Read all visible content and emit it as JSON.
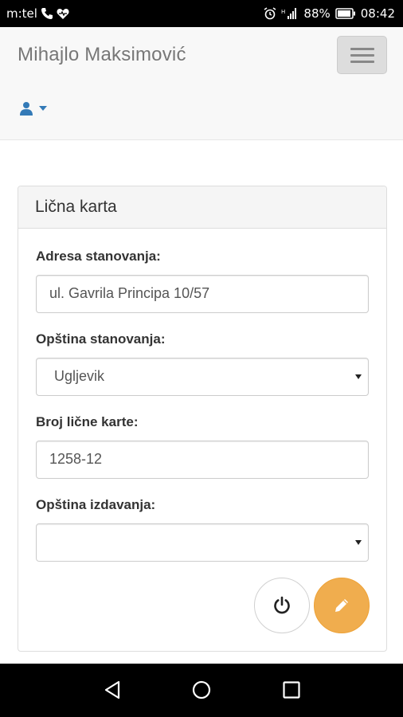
{
  "status_bar": {
    "carrier": "m:tel",
    "battery": "88%",
    "time": "08:42"
  },
  "navbar": {
    "brand": "Mihajlo Maksimović"
  },
  "panel": {
    "title": "Lična karta",
    "fields": [
      {
        "label": "Adresa stanovanja:",
        "value": "ul. Gavrila Principa 10/57",
        "type": "text"
      },
      {
        "label": "Opština stanovanja:",
        "value": "Ugljevik",
        "type": "select"
      },
      {
        "label": "Broj lične karte:",
        "value": "1258-12",
        "type": "text"
      },
      {
        "label": "Opština izdavanja:",
        "value": "",
        "type": "select"
      }
    ]
  },
  "icons": {
    "power": "power-icon",
    "edit": "pencil-icon",
    "user": "user-icon"
  },
  "colors": {
    "edit_button": "#f0ad4e",
    "user_icon": "#337ab7",
    "navbar_bg": "#f8f8f8"
  }
}
